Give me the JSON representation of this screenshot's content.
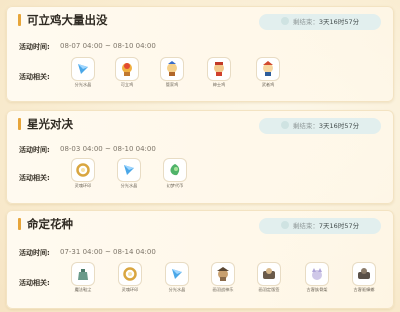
{
  "events": [
    {
      "title": "可立鸡大量出没",
      "timer_label": "剩结束：",
      "timer_value": "3天16时57分",
      "time_label": "活动时间:",
      "time_value": "08-07 04:00 ~ 08-10 04:00",
      "related_label": "活动相关:",
      "items": [
        {
          "name": "分光水晶",
          "icon": "crystal-icon"
        },
        {
          "name": "可立鸡",
          "icon": "pet-icon"
        },
        {
          "name": "管家鸡",
          "icon": "pet-icon"
        },
        {
          "name": "绅士鸡",
          "icon": "pet-icon"
        },
        {
          "name": "武者鸡",
          "icon": "pet-icon"
        }
      ]
    },
    {
      "title": "星光对决",
      "timer_label": "剩结束：",
      "timer_value": "3天16时57分",
      "time_label": "活动时间:",
      "time_value": "08-03 04:00 ~ 08-10 04:00",
      "related_label": "活动相关:",
      "items": [
        {
          "name": "灵魂环印",
          "icon": "ring-icon"
        },
        {
          "name": "分光水晶",
          "icon": "crystal-icon"
        },
        {
          "name": "幻梦代币",
          "icon": "token-icon"
        }
      ]
    },
    {
      "title": "命定花种",
      "timer_label": "剩结束：",
      "timer_value": "7天16时57分",
      "time_label": "活动时间:",
      "time_value": "07-31 04:00 ~ 08-14 04:00",
      "related_label": "活动相关:",
      "items": [
        {
          "name": "魔法鞋尘",
          "icon": "bag-icon"
        },
        {
          "name": "灵魂环印",
          "icon": "ring-icon"
        },
        {
          "name": "分光水晶",
          "icon": "crystal-icon"
        },
        {
          "name": "画羽战神乐",
          "icon": "pet-icon"
        },
        {
          "name": "画羽定版签",
          "icon": "pet-icon"
        },
        {
          "name": "古客族骨架",
          "icon": "pet-icon"
        },
        {
          "name": "古客驱蟑螂",
          "icon": "pet-icon"
        }
      ]
    }
  ],
  "colors": {
    "accent": "#e7a53a",
    "timer_bg": "#e2efee",
    "card_bg": "#fffaf0"
  }
}
